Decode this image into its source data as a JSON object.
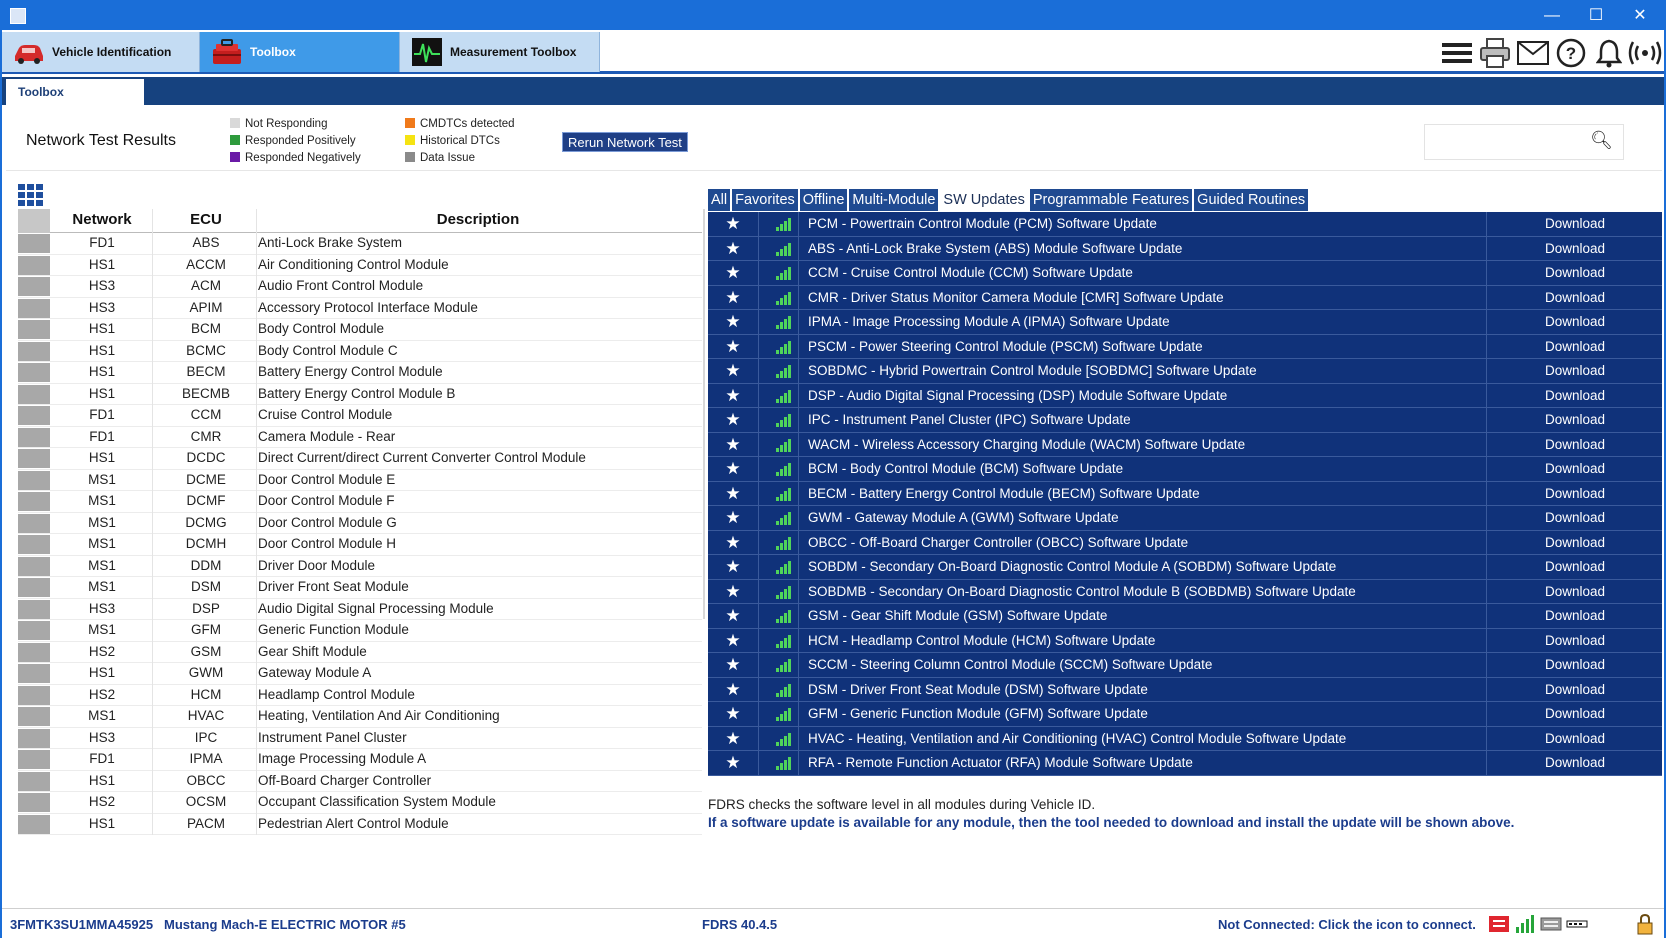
{
  "window": {
    "minimize": "—",
    "maximize": "☐",
    "close": "✕"
  },
  "top_tabs": [
    {
      "label": "Vehicle Identification"
    },
    {
      "label": "Toolbox"
    },
    {
      "label": "Measurement Toolbox"
    }
  ],
  "toolbar_icons": [
    "menu-icon",
    "printer-icon",
    "mail-icon",
    "help-icon",
    "bell-icon",
    "connection-icon"
  ],
  "sub_tab": {
    "label": "Toolbox"
  },
  "header": {
    "title": "Network Test Results",
    "rerun_label": "Rerun Network Test",
    "search_placeholder": ""
  },
  "legend": [
    {
      "label": "Not Responding",
      "color": "#d9d9d9"
    },
    {
      "label": "Responded Positively",
      "color": "#2e9b3c"
    },
    {
      "label": "Responded Negatively",
      "color": "#6a1aa6"
    },
    {
      "label": "CMDTCs detected",
      "color": "#f07a1a"
    },
    {
      "label": "Historical DTCs",
      "color": "#f5e312"
    },
    {
      "label": "Data Issue",
      "color": "#8a8a8a"
    }
  ],
  "left_table": {
    "headers": [
      "Network",
      "ECU",
      "Description"
    ],
    "rows": [
      [
        "FD1",
        "ABS",
        "Anti-Lock Brake System"
      ],
      [
        "HS1",
        "ACCM",
        "Air Conditioning Control Module"
      ],
      [
        "HS3",
        "ACM",
        "Audio Front Control Module"
      ],
      [
        "HS3",
        "APIM",
        "Accessory Protocol Interface Module"
      ],
      [
        "HS1",
        "BCM",
        "Body Control Module"
      ],
      [
        "HS1",
        "BCMC",
        "Body Control Module C"
      ],
      [
        "HS1",
        "BECM",
        "Battery Energy Control Module"
      ],
      [
        "HS1",
        "BECMB",
        "Battery Energy Control Module B"
      ],
      [
        "FD1",
        "CCM",
        "Cruise Control Module"
      ],
      [
        "FD1",
        "CMR",
        "Camera Module - Rear"
      ],
      [
        "HS1",
        "DCDC",
        "Direct Current/direct Current Converter Control Module"
      ],
      [
        "MS1",
        "DCME",
        "Door Control Module E"
      ],
      [
        "MS1",
        "DCMF",
        "Door Control Module F"
      ],
      [
        "MS1",
        "DCMG",
        "Door Control Module G"
      ],
      [
        "MS1",
        "DCMH",
        "Door Control Module H"
      ],
      [
        "MS1",
        "DDM",
        "Driver Door Module"
      ],
      [
        "MS1",
        "DSM",
        "Driver Front Seat Module"
      ],
      [
        "HS3",
        "DSP",
        "Audio Digital Signal Processing Module"
      ],
      [
        "MS1",
        "GFM",
        "Generic Function Module"
      ],
      [
        "HS2",
        "GSM",
        "Gear Shift Module"
      ],
      [
        "HS1",
        "GWM",
        "Gateway Module A"
      ],
      [
        "HS2",
        "HCM",
        "Headlamp Control Module"
      ],
      [
        "MS1",
        "HVAC",
        "Heating, Ventilation And Air Conditioning"
      ],
      [
        "HS3",
        "IPC",
        "Instrument Panel Cluster"
      ],
      [
        "FD1",
        "IPMA",
        "Image Processing Module A"
      ],
      [
        "HS1",
        "OBCC",
        "Off-Board Charger Controller"
      ],
      [
        "HS2",
        "OCSM",
        "Occupant Classification System Module"
      ],
      [
        "HS1",
        "PACM",
        "Pedestrian Alert Control Module"
      ]
    ]
  },
  "filter_tabs": [
    {
      "label": "All",
      "active": false
    },
    {
      "label": "Favorites",
      "active": false
    },
    {
      "label": "Offline",
      "active": false
    },
    {
      "label": "Multi-Module",
      "active": false
    },
    {
      "label": "SW Updates",
      "active": true
    },
    {
      "label": "Programmable Features",
      "active": false
    },
    {
      "label": "Guided Routines",
      "active": false
    }
  ],
  "updates": {
    "action_label": "Download",
    "rows": [
      "PCM - Powertrain Control Module (PCM) Software Update",
      "ABS - Anti-Lock Brake System (ABS) Module Software Update",
      "CCM - Cruise Control Module (CCM) Software Update",
      "CMR - Driver Status Monitor Camera Module [CMR] Software Update",
      "IPMA - Image Processing Module A (IPMA) Software Update",
      "PSCM - Power Steering Control Module (PSCM) Software Update",
      "SOBDMC - Hybrid Powertrain Control Module [SOBDMC] Software Update",
      "DSP - Audio Digital Signal Processing (DSP) Module Software Update",
      "IPC - Instrument Panel Cluster (IPC) Software Update",
      "WACM - Wireless Accessory Charging Module (WACM) Software Update",
      "BCM - Body Control Module (BCM) Software Update",
      "BECM - Battery Energy Control Module (BECM) Software Update",
      "GWM - Gateway Module A (GWM) Software Update",
      "OBCC - Off-Board Charger Controller (OBCC) Software Update",
      "SOBDM - Secondary On-Board Diagnostic Control Module A (SOBDM) Software Update",
      "SOBDMB - Secondary On-Board Diagnostic Control Module B (SOBDMB) Software Update",
      "GSM - Gear Shift Module (GSM) Software Update",
      "HCM - Headlamp Control Module (HCM) Software Update",
      "SCCM - Steering Column Control Module (SCCM) Software Update",
      "DSM - Driver Front Seat Module (DSM) Software Update",
      "GFM - Generic Function Module (GFM) Software Update",
      "HVAC - Heating, Ventilation and Air Conditioning (HVAC) Control Module Software Update",
      "RFA - Remote Function Actuator (RFA) Module Software Update"
    ]
  },
  "notes": {
    "line1": "FDRS checks the software level in all modules during Vehicle ID.",
    "line2": "If a software update is available for any module, then the tool needed to download and install the update will be shown above."
  },
  "status": {
    "vin": "3FMTK3SU1MMA45925",
    "vehicle": "Mustang Mach-E ELECTRIC MOTOR #5",
    "version": "FDRS 40.4.5",
    "connection": "Not Connected: Click the icon to connect."
  }
}
